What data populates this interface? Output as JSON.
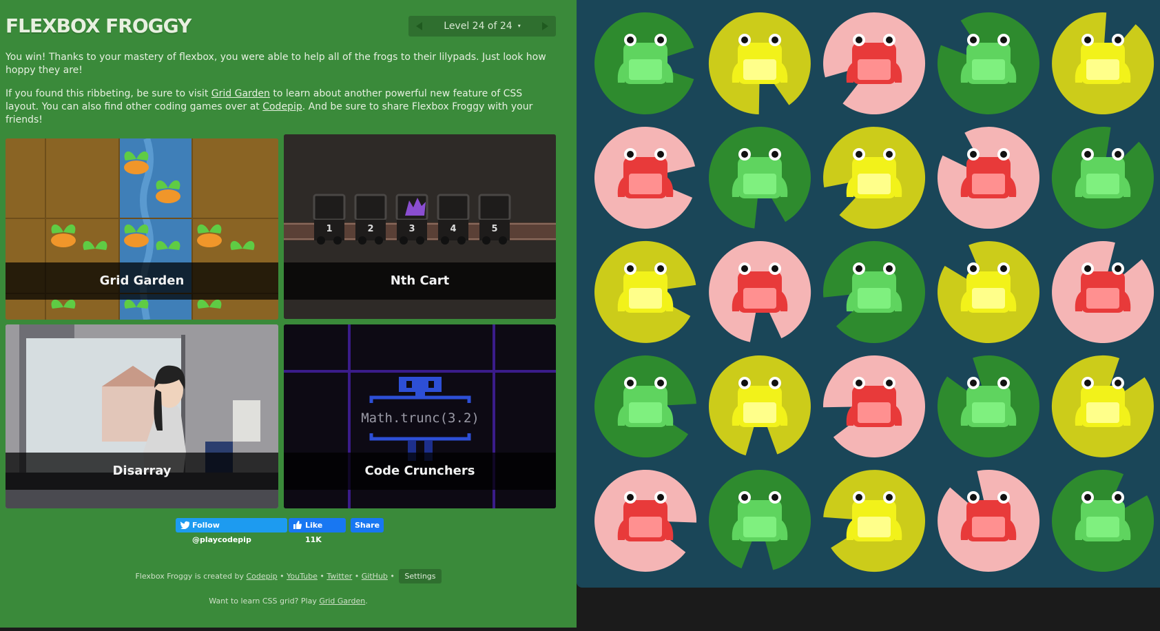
{
  "app": {
    "title": "FLEXBOX FROGGY"
  },
  "level_nav": {
    "label": "Level 24 of 24",
    "caret": "▾"
  },
  "intro": {
    "win_text": "You win! Thanks to your mastery of flexbox, you were able to help all of the frogs to their lilypads. Just look how hoppy they are!",
    "more_prefix": "If you found this ribbeting, be sure to visit ",
    "grid_garden_link": "Grid Garden",
    "more_middle": " to learn about another powerful new feature of CSS layout. You can also find other coding games over at ",
    "codepip_link": "Codepip",
    "more_suffix": ". And be sure to share Flexbox Froggy with your friends!"
  },
  "games": [
    {
      "name": "Grid Garden"
    },
    {
      "name": "Nth Cart"
    },
    {
      "name": "Disarray"
    },
    {
      "name": "Code Crunchers"
    }
  ],
  "nth_cart": {
    "cart_numbers": [
      "1",
      "2",
      "3",
      "4",
      "5"
    ]
  },
  "code_crunchers": {
    "expression": "Math.trunc(3.2)"
  },
  "social": {
    "follow_label": "Follow @playcodepip",
    "like_label": "Like 11K",
    "share_label": "Share"
  },
  "footer": {
    "created_by_prefix": "Flexbox Froggy is created by ",
    "codepip": "Codepip",
    "sep": "•",
    "youtube": "YouTube",
    "twitter": "Twitter",
    "github": "GitHub",
    "settings": "Settings",
    "learn_prefix": "Want to learn CSS grid? Play ",
    "grid_garden": "Grid Garden",
    "learn_suffix": "."
  },
  "pond": {
    "colors": {
      "green": {
        "pad": "#2e8b2e",
        "frog": "#5fd45f",
        "belly": "#7ff07f"
      },
      "yellow": {
        "pad": "#cccc1a",
        "frog": "#f2f21a",
        "belly": "#ffff8a"
      },
      "red": {
        "pad": "#f5b5b5",
        "frog": "#e83a3a",
        "belly": "#ff9090"
      },
      "background": "#1a4658"
    },
    "rows": [
      [
        "green",
        "yellow",
        "red",
        "green",
        "yellow"
      ],
      [
        "red",
        "green",
        "yellow",
        "red",
        "green"
      ],
      [
        "yellow",
        "red",
        "green",
        "yellow",
        "red"
      ],
      [
        "green",
        "yellow",
        "red",
        "green",
        "yellow"
      ],
      [
        "red",
        "green",
        "yellow",
        "red",
        "green"
      ]
    ]
  }
}
